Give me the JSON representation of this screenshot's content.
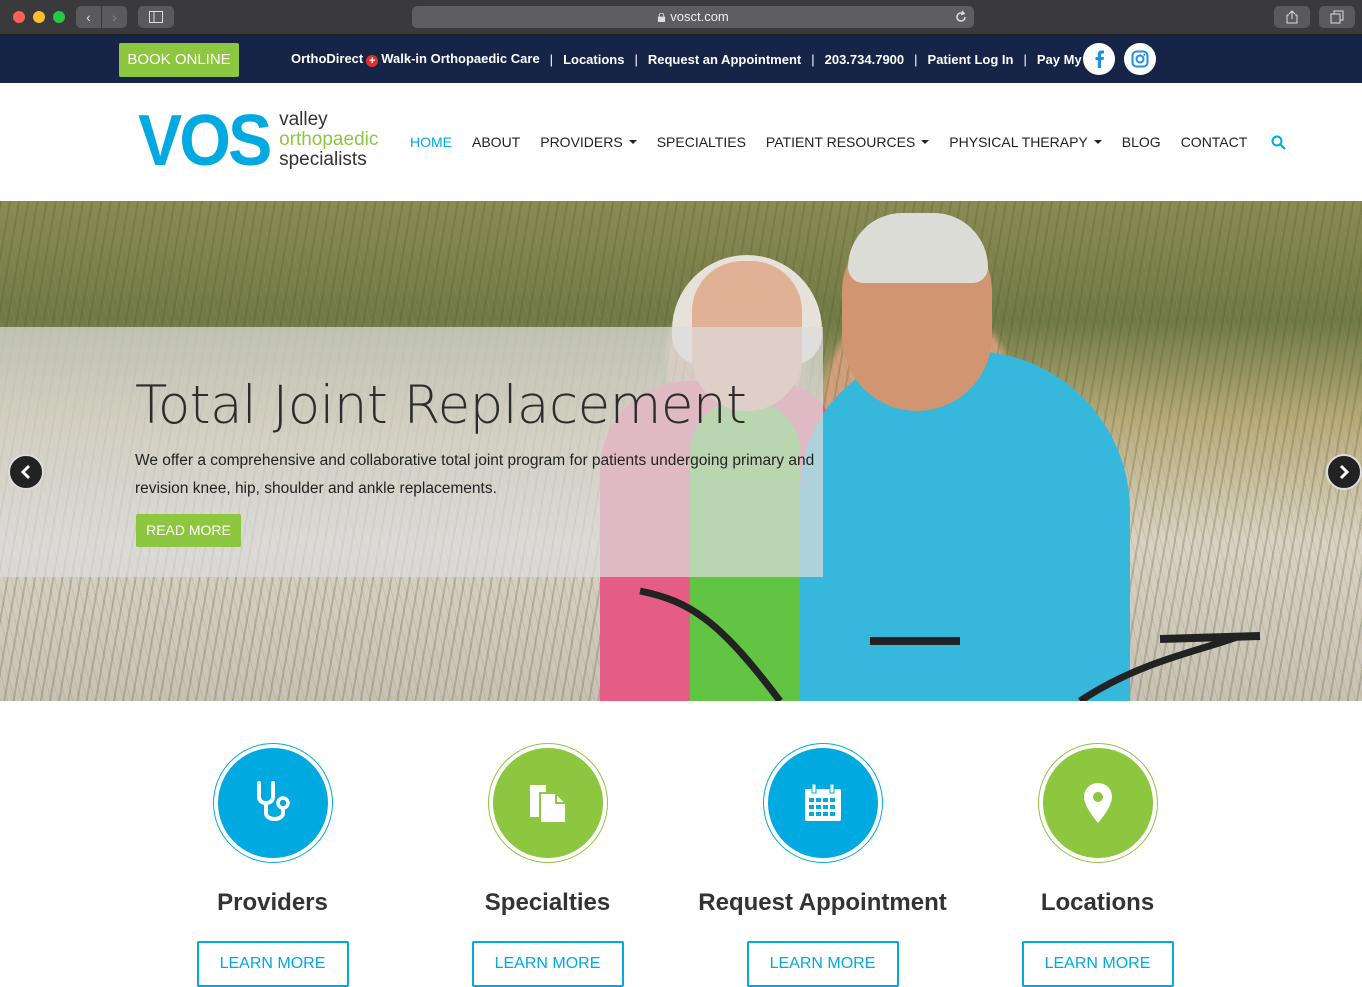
{
  "browser": {
    "url": "vosct.com"
  },
  "utility": {
    "book_online": "BOOK ONLINE",
    "orthodirect": "OrthoDirect",
    "walkin": "Walk-in Orthopaedic Care",
    "locations": "Locations",
    "request": "Request an Appointment",
    "phone": "203.734.7900",
    "patient_login": "Patient Log In",
    "pay_bill": "Pay My Bill",
    "separator": "|"
  },
  "logo": {
    "mark": "VOS",
    "line1": "valley",
    "line2": "orthopaedic",
    "line3": "specialists"
  },
  "nav": {
    "home": "HOME",
    "about": "ABOUT",
    "providers": "PROVIDERS",
    "specialties": "SPECIALTIES",
    "patient_resources": "PATIENT RESOURCES",
    "physical_therapy": "PHYSICAL THERAPY",
    "blog": "BLOG",
    "contact": "CONTACT"
  },
  "hero": {
    "title": "Total Joint Replacement",
    "text": "We offer a comprehensive and collaborative total joint program for patients undergoing primary and revision knee, hip, shoulder and ankle replacements.",
    "button": "READ MORE"
  },
  "features": [
    {
      "title": "Providers",
      "button": "LEARN MORE",
      "icon": "stethoscope-icon"
    },
    {
      "title": "Specialties",
      "button": "LEARN MORE",
      "icon": "documents-icon"
    },
    {
      "title": "Request Appointment",
      "button": "LEARN MORE",
      "icon": "calendar-icon"
    },
    {
      "title": "Locations",
      "button": "LEARN MORE",
      "icon": "map-pin-icon"
    }
  ],
  "colors": {
    "brand_blue": "#00a9e0",
    "brand_green": "#8dc63f",
    "navy": "#152447"
  }
}
